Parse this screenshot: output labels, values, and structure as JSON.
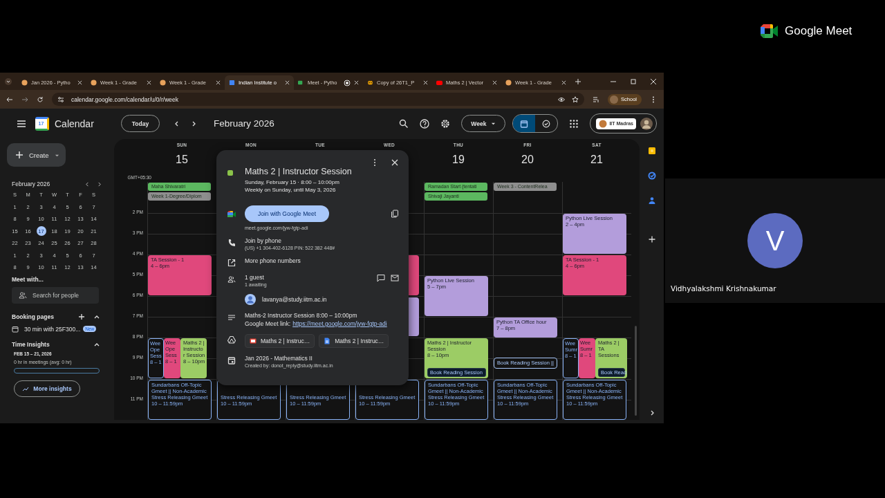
{
  "browser": {
    "tabs": [
      {
        "title": "Jan 2026 - Pytho",
        "kind": "course",
        "selected": false,
        "recording": false
      },
      {
        "title": "Week 1 - Grade",
        "kind": "course",
        "selected": false,
        "recording": false
      },
      {
        "title": "Week 1 - Grade",
        "kind": "course",
        "selected": false,
        "recording": false
      },
      {
        "title": "Indian Institute o",
        "kind": "calendar",
        "selected": true,
        "recording": false
      },
      {
        "title": "Meet - Pytho",
        "kind": "meet",
        "selected": false,
        "recording": true
      },
      {
        "title": "Copy of 26T1_P",
        "kind": "copy",
        "selected": false,
        "recording": false
      },
      {
        "title": "Maths 2 | Vector",
        "kind": "video",
        "selected": false,
        "recording": false
      },
      {
        "title": "Week 1 - Grade",
        "kind": "course",
        "selected": false,
        "recording": false
      }
    ],
    "address": "calendar.google.com/calendar/u/0/r/week",
    "profile": "School"
  },
  "header": {
    "logo_day": "17",
    "app_name": "Calendar",
    "today": "Today",
    "period": "February 2026",
    "view": "Week",
    "account": "IIT Madras",
    "view_toggle": [
      {
        "kind": "calendar",
        "selected": true
      },
      {
        "kind": "tasks",
        "selected": false
      }
    ]
  },
  "sidebar": {
    "create": "Create",
    "mini_calendar": {
      "title": "February 2026",
      "weekdays": [
        "S",
        "M",
        "T",
        "W",
        "T",
        "F",
        "S"
      ],
      "days": [
        {
          "day": "1",
          "selected": false
        },
        {
          "day": "2",
          "selected": false
        },
        {
          "day": "3",
          "selected": false
        },
        {
          "day": "4",
          "selected": false
        },
        {
          "day": "5",
          "selected": false
        },
        {
          "day": "6",
          "selected": false
        },
        {
          "day": "7",
          "selected": false
        },
        {
          "day": "8",
          "selected": false
        },
        {
          "day": "9",
          "selected": false
        },
        {
          "day": "10",
          "selected": false
        },
        {
          "day": "11",
          "selected": false
        },
        {
          "day": "12",
          "selected": false
        },
        {
          "day": "13",
          "selected": false
        },
        {
          "day": "14",
          "selected": false
        },
        {
          "day": "15",
          "selected": false
        },
        {
          "day": "16",
          "selected": false
        },
        {
          "day": "17",
          "selected": true
        },
        {
          "day": "18",
          "selected": false
        },
        {
          "day": "19",
          "selected": false
        },
        {
          "day": "20",
          "selected": false
        },
        {
          "day": "21",
          "selected": false
        },
        {
          "day": "22",
          "selected": false
        },
        {
          "day": "23",
          "selected": false
        },
        {
          "day": "24",
          "selected": false
        },
        {
          "day": "25",
          "selected": false
        },
        {
          "day": "26",
          "selected": false
        },
        {
          "day": "27",
          "selected": false
        },
        {
          "day": "28",
          "selected": false
        },
        {
          "day": "1",
          "selected": false
        },
        {
          "day": "2",
          "selected": false
        },
        {
          "day": "3",
          "selected": false
        },
        {
          "day": "4",
          "selected": false
        },
        {
          "day": "5",
          "selected": false
        },
        {
          "day": "6",
          "selected": false
        },
        {
          "day": "7",
          "selected": false
        },
        {
          "day": "8",
          "selected": false
        },
        {
          "day": "9",
          "selected": false
        },
        {
          "day": "10",
          "selected": false
        },
        {
          "day": "11",
          "selected": false
        },
        {
          "day": "12",
          "selected": false
        },
        {
          "day": "13",
          "selected": false
        },
        {
          "day": "14",
          "selected": false
        }
      ]
    },
    "meet_with": {
      "heading": "Meet with...",
      "placeholder": "Search for people"
    },
    "booking": {
      "heading": "Booking pages",
      "item": "30 min with 25F300...",
      "badge": "New"
    },
    "insights": {
      "heading": "Time Insights",
      "range": "FEB 15 – 21, 2026",
      "summary": "0 hr in meetings (avg: 0 hr)",
      "level": 0,
      "button": "More insights"
    }
  },
  "grid": {
    "timezone": "GMT+05:30",
    "hours": [
      "2 PM",
      "3 PM",
      "4 PM",
      "5 PM",
      "6 PM",
      "7 PM",
      "8 PM",
      "9 PM",
      "10 PM",
      "11 PM"
    ],
    "days": [
      {
        "weekday": "SUN",
        "date": "15",
        "all_day": [
          {
            "title": "Maha Shivaratri",
            "color": "#5cb860"
          },
          {
            "title": "Week 1-Degree/Diplom",
            "color": "#8e8e8e"
          }
        ],
        "events": [
          {
            "lines": [
              "TA Session - 1",
              "4 – 6pm"
            ],
            "color": "#e0487c",
            "kind": "filled"
          },
          {
            "lines": [
              "Wee",
              "Ope",
              "Sess",
              "8 – 1"
            ],
            "color": "#8ab4f8",
            "kind": "outlined"
          },
          {
            "lines": [
              "Wee",
              "Ope",
              "Sess",
              "8 – 1"
            ],
            "color": "#e0487c",
            "kind": "filled"
          },
          {
            "lines": [
              "Maths 2 |",
              "Instructo",
              "r Session",
              "8 – 10pm"
            ],
            "color": "#9ccc65",
            "kind": "filled"
          },
          {
            "lines": [
              "Sundarbans Off-Topic",
              "Gmeet || Non-Academic",
              "Stress Releasing Gmeet",
              "10 – 11:59pm"
            ],
            "color": "#8ab4f8",
            "kind": "outlined"
          }
        ]
      },
      {
        "weekday": "MON",
        "events": [
          {
            "lines": [
              "Stress Releasing Gmeet",
              "10 – 11:59pm"
            ],
            "color": "#8ab4f8",
            "kind": "outlined"
          }
        ]
      },
      {
        "weekday": "TUE",
        "events": [
          {
            "lines": [
              "Stress Releasing Gmeet",
              "10 – 11:59pm"
            ],
            "color": "#8ab4f8",
            "kind": "outlined"
          }
        ]
      },
      {
        "weekday": "WED",
        "events": [
          {
            "color": "#e0487c",
            "kind": "filled"
          },
          {
            "color": "#b39ddb",
            "kind": "filled"
          },
          {
            "lines": [
              "Stress Releasing Gmeet",
              "10 – 11:59pm"
            ],
            "color": "#8ab4f8",
            "kind": "outlined"
          }
        ]
      },
      {
        "weekday": "THU",
        "date": "19",
        "all_day": [
          {
            "title": "Ramadan Start (tentati",
            "color": "#5cb860"
          },
          {
            "title": "Shivaji Jayanti",
            "color": "#5cb860"
          }
        ],
        "events": [
          {
            "lines": [
              "Python Live Session",
              "5 – 7pm"
            ],
            "color": "#b39ddb",
            "kind": "filled"
          },
          {
            "lines": [
              "Maths 2 | Instructor",
              "Session",
              "8 – 10pm"
            ],
            "color": "#9ccc65",
            "kind": "filled",
            "chip": "Book Reading Session"
          },
          {
            "lines": [
              "Sundarbans Off-Topic",
              "Gmeet || Non-Academic",
              "Stress Releasing Gmeet",
              "10 – 11:59pm"
            ],
            "color": "#8ab4f8",
            "kind": "outlined"
          }
        ]
      },
      {
        "weekday": "FRI",
        "date": "20",
        "all_day": [
          {
            "title": "Week 3 - ContentRelea",
            "color": "#8e8e8e"
          }
        ],
        "events": [
          {
            "lines": [
              "Python TA Office hour",
              "7 – 8pm"
            ],
            "color": "#b39ddb",
            "kind": "filled"
          },
          {
            "lines": [
              "Book Reading Session ||"
            ],
            "color": "#a8c7fa",
            "kind": "outlined"
          },
          {
            "lines": [
              "Sundarbans Off-Topic",
              "Gmeet || Non-Academic",
              "Stress Releasing Gmeet",
              "10 – 11:59pm"
            ],
            "color": "#8ab4f8",
            "kind": "outlined"
          }
        ]
      },
      {
        "weekday": "SAT",
        "date": "21",
        "events": [
          {
            "lines": [
              "Python Live Session",
              "2 – 4pm"
            ],
            "color": "#b39ddb",
            "kind": "filled"
          },
          {
            "lines": [
              "TA Session - 1",
              "4 – 6pm"
            ],
            "color": "#e0487c",
            "kind": "filled"
          },
          {
            "lines": [
              "Wee",
              "Sumr",
              "8 – 1"
            ],
            "color": "#8ab4f8",
            "kind": "outlined"
          },
          {
            "lines": [
              "Wee",
              "Sumr",
              "8 – 1"
            ],
            "color": "#e0487c",
            "kind": "filled"
          },
          {
            "lines": [
              "Maths 2 |",
              "TA",
              "Sessions"
            ],
            "color": "#9ccc65",
            "kind": "filled",
            "chip": "Book Read"
          },
          {
            "lines": [
              "Sundarbans Off-Topic",
              "Gmeet || Non-Academic",
              "Stress Releasing Gmeet",
              "10 – 11:59pm"
            ],
            "color": "#8ab4f8",
            "kind": "outlined"
          }
        ]
      }
    ]
  },
  "popup": {
    "color": "#8bc34a",
    "title": "Maths 2 | Instructor Session",
    "when": "Sunday, February 15  ·  8:00 – 10:00pm",
    "recurrence": "Weekly on Sunday, until May 3, 2026",
    "join_button": "Join with Google Meet",
    "meet_url": "meet.google.com/jyw-fgtp-adi",
    "phone_heading": "Join by phone",
    "phone_detail": "(US) +1 304-402-6128 PIN: 522 382 448#",
    "more_numbers": "More phone numbers",
    "guests": "1 guest",
    "awaiting": "1 awaiting",
    "guest_email": "lavanya@study.iitm.ac.in",
    "description": "Maths-2 Instructor Session 8:00 – 10:00pm",
    "link_label": "Google Meet link:",
    "link": "https://meet.google.com/jyw-fgtp-adi",
    "attachments": [
      {
        "kind": "slides",
        "title": "Maths 2 | Instruc…"
      },
      {
        "kind": "doc",
        "title": "Maths 2 | Instruc…"
      }
    ],
    "calendar_name": "Jan 2026 - Mathematics II",
    "creator": "Created by: donot_reply@study.iitm.ac.in"
  },
  "meet": {
    "brand": "Google Meet",
    "participant": {
      "initial": "V",
      "name": "Vidhyalakshmi Krishnakumar"
    }
  }
}
